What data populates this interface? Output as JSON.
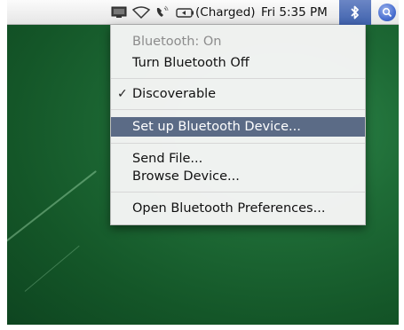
{
  "menubar": {
    "battery_status": "(Charged)",
    "clock": "Fri 5:35 PM",
    "icons": [
      "display-mirroring-icon",
      "airport-wifi-icon",
      "phone-icon",
      "battery-icon",
      "bluetooth-icon",
      "spotlight-icon"
    ]
  },
  "bluetooth_menu": {
    "status": "Bluetooth: On",
    "toggle": "Turn Bluetooth Off",
    "discoverable": "Discoverable",
    "check_mark": "✓",
    "setup_device": "Set up Bluetooth Device...",
    "send_file": "Send File...",
    "browse_device": "Browse Device...",
    "open_prefs": "Open Bluetooth Preferences..."
  },
  "colors": {
    "highlight": "#5b6b86",
    "menubar_active": "#4a6bb5",
    "desktop_green": "#1e6b36"
  }
}
